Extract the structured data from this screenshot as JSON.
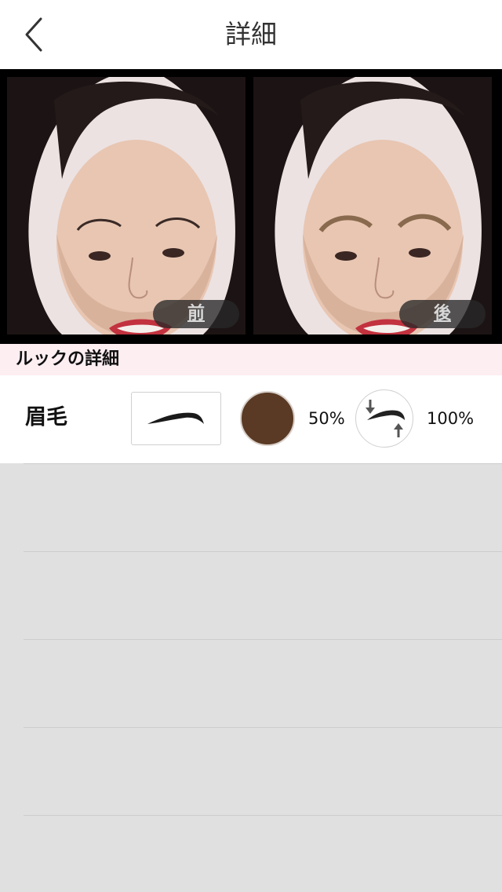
{
  "nav": {
    "title": "詳細",
    "back_icon": "chevron-left-icon"
  },
  "compare": {
    "before_label": "前",
    "after_label": "後"
  },
  "section": {
    "title": "ルックの詳細"
  },
  "eyebrow": {
    "label": "眉毛",
    "shape_icon": "eyebrow-shape-icon",
    "color": "#5a3a24",
    "opacity": "50%",
    "position_icon": "eyebrow-position-icon",
    "scale": "100%"
  },
  "colors": {
    "nav_background": "#ffffff",
    "section_background": "#fdeef2",
    "list_background": "#e0e0e0"
  }
}
